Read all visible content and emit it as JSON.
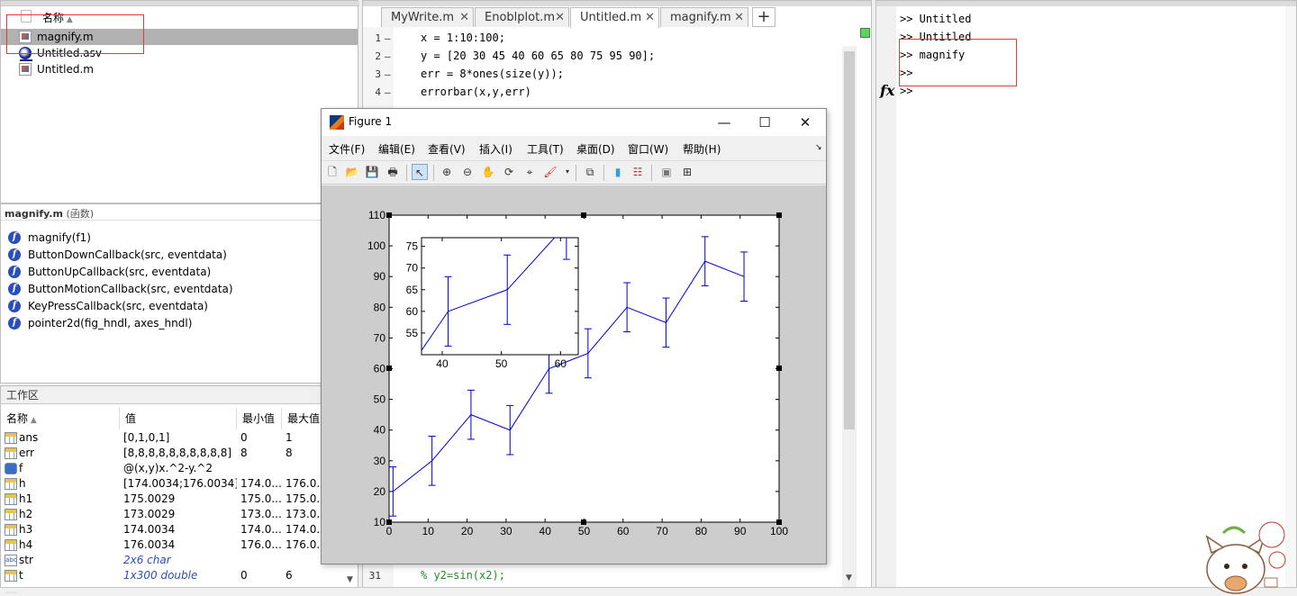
{
  "folder": {
    "column_header": "名称",
    "files": [
      {
        "name": "magnify.m",
        "icon": "m-file-icon",
        "selected": true
      },
      {
        "name": "Untitled.asv",
        "icon": "asv-file-icon",
        "selected": false
      },
      {
        "name": "Untitled.m",
        "icon": "m-file-icon",
        "selected": false
      }
    ]
  },
  "details": {
    "title": "magnify.m",
    "subtitle": "(函数)",
    "functions": [
      "magnify(f1)",
      "ButtonDownCallback(src, eventdata)",
      "ButtonUpCallback(src, eventdata)",
      "ButtonMotionCallback(src, eventdata)",
      "KeyPressCallback(src, eventdata)",
      "pointer2d(fig_hndl, axes_hndl)"
    ]
  },
  "workspace": {
    "title": "工作区",
    "headers": {
      "name": "名称",
      "value": "值",
      "min": "最小值",
      "max": "最大值"
    },
    "rows": [
      {
        "name": "ans",
        "value": "[0,1,0,1]",
        "min": "0",
        "max": "1",
        "icon": "matrix-icon",
        "italic": false
      },
      {
        "name": "err",
        "value": "[8,8,8,8,8,8,8,8,8,8]",
        "min": "8",
        "max": "8",
        "icon": "matrix-icon",
        "italic": false
      },
      {
        "name": "f",
        "value": "@(x,y)x.^2-y.^2",
        "min": "",
        "max": "",
        "icon": "function-handle-icon",
        "italic": false
      },
      {
        "name": "h",
        "value": "[174.0034;176.0034]",
        "min": "174.0...",
        "max": "176.0...",
        "icon": "matrix-icon",
        "italic": false
      },
      {
        "name": "h1",
        "value": "175.0029",
        "min": "175.0...",
        "max": "175.0...",
        "icon": "matrix-icon",
        "italic": false
      },
      {
        "name": "h2",
        "value": "173.0029",
        "min": "173.0...",
        "max": "173.0...",
        "icon": "matrix-icon",
        "italic": false
      },
      {
        "name": "h3",
        "value": "174.0034",
        "min": "174.0...",
        "max": "174.0...",
        "icon": "matrix-icon",
        "italic": false
      },
      {
        "name": "h4",
        "value": "176.0034",
        "min": "176.0...",
        "max": "176.0...",
        "icon": "matrix-icon",
        "italic": false
      },
      {
        "name": "str",
        "value": "2x6 char",
        "min": "",
        "max": "",
        "icon": "string-icon",
        "italic": true
      },
      {
        "name": "t",
        "value": "1x300 double",
        "min": "0",
        "max": "6",
        "icon": "matrix-icon",
        "italic": true
      }
    ]
  },
  "editor": {
    "tabs": [
      {
        "label": "MyWrite.m",
        "active": false
      },
      {
        "label": "Enoblplot.m",
        "active": false
      },
      {
        "label": "Untitled.m",
        "active": true
      },
      {
        "label": "magnify.m",
        "active": false
      }
    ],
    "plus_label": "+",
    "lines": [
      {
        "num": "1",
        "text": "x = 1:10:100;",
        "comment": false
      },
      {
        "num": "2",
        "text": "y = [20 30 45 40 60 65 80 75 95 90];",
        "comment": false
      },
      {
        "num": "3",
        "text": "err = 8*ones(size(y));",
        "comment": false
      },
      {
        "num": "4",
        "text": "errorbar(x,y,err)",
        "comment": false
      }
    ],
    "last_line": {
      "num": "31",
      "text": "% y2=sin(x2);",
      "comment": true
    }
  },
  "command": {
    "lines": [
      ">> Untitled",
      ">> Untitled",
      ">> magnify",
      ">>",
      ">>"
    ],
    "fx_label": "fx"
  },
  "figure": {
    "title": "Figure 1",
    "window_buttons": {
      "minimize": "—",
      "maximize": "☐",
      "close": "✕"
    },
    "menus": [
      "文件(F)",
      "编辑(E)",
      "查看(V)",
      "插入(I)",
      "工具(T)",
      "桌面(D)",
      "窗口(W)",
      "帮助(H)"
    ],
    "menu_arrow": "↘"
  },
  "chart_data": [
    {
      "type": "line",
      "subtype": "errorbar",
      "x": [
        1,
        11,
        21,
        31,
        41,
        51,
        61,
        71,
        81,
        91
      ],
      "series": [
        {
          "values": [
            20,
            30,
            45,
            40,
            60,
            65,
            80,
            75,
            95,
            90
          ],
          "error": [
            8,
            8,
            8,
            8,
            8,
            8,
            8,
            8,
            8,
            8
          ],
          "color": "#0000cc"
        }
      ],
      "xlim": [
        0,
        100
      ],
      "ylim": [
        10,
        110
      ],
      "xticks": [
        "0",
        "10",
        "20",
        "30",
        "40",
        "50",
        "60",
        "70",
        "80",
        "90",
        "100"
      ],
      "yticks": [
        "10",
        "20",
        "30",
        "40",
        "50",
        "60",
        "70",
        "80",
        "90",
        "100",
        "110"
      ],
      "grid": false,
      "title": "",
      "xlabel": "",
      "ylabel": ""
    },
    {
      "type": "line",
      "subtype": "errorbar-inset",
      "xlim": [
        36.5,
        63
      ],
      "ylim": [
        50,
        77
      ],
      "xticks": [
        "40",
        "50",
        "60"
      ],
      "yticks": [
        "55",
        "60",
        "65",
        "70",
        "75"
      ],
      "grid": false,
      "title": "",
      "xlabel": "",
      "ylabel": ""
    }
  ],
  "colors": {
    "accent": "#0000cc",
    "annotation": "#e53935"
  }
}
